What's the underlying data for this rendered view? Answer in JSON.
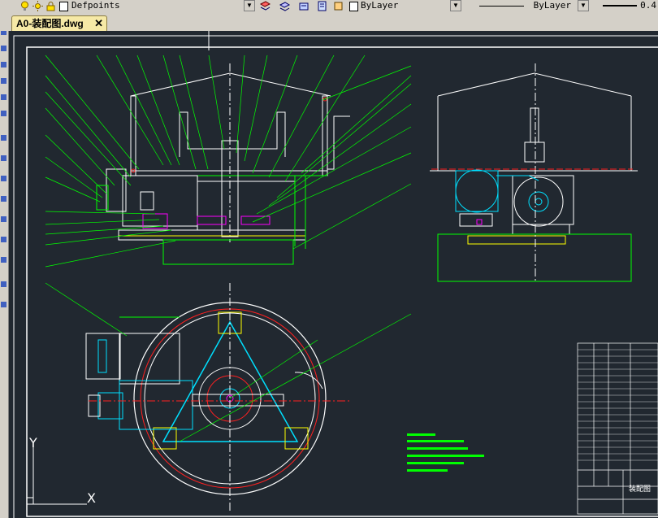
{
  "toolbar": {
    "layer_name": "Defpoints",
    "color_value": "ByLayer",
    "linetype_value": "ByLayer",
    "lineweight_value": "0.4"
  },
  "tab": {
    "title": "A0-装配图.dwg",
    "close_glyph": "✕"
  },
  "drawing": {
    "ucs_y": "Y",
    "ucs_x": "X",
    "title_block_label": "装配图",
    "colors": {
      "background": "#212830",
      "green": "#00ff00",
      "cyan": "#00e0ff",
      "white": "#ffffff",
      "yellow": "#ffff00",
      "magenta": "#ff00ff",
      "red": "#ff2020"
    }
  }
}
